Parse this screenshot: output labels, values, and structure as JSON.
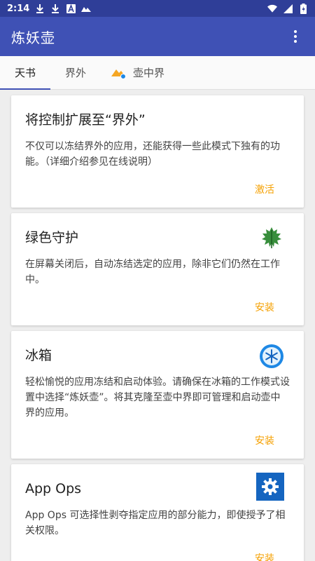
{
  "status_bar": {
    "time": "2:14"
  },
  "app_bar": {
    "title": "炼妖壶"
  },
  "tabs": [
    {
      "label": "天书"
    },
    {
      "label": "界外"
    },
    {
      "label": "壶中界"
    }
  ],
  "cards": [
    {
      "title": "将控制扩展至“界外”",
      "description": "不仅可以冻结界外的应用，还能获得一些此模式下独有的功能。（详细介绍参见在线说明）",
      "action": "激活"
    },
    {
      "title": "绿色守护",
      "description": "在屏幕关闭后，自动冻结选定的应用，除非它们仍然在工作中。",
      "action": "安装"
    },
    {
      "title": "冰箱",
      "description": "轻松愉悦的应用冻结和启动体验。请确保在冰箱的工作模式设置中选择“炼妖壶”。将其克隆至壶中界即可管理和启动壶中界的应用。",
      "action": "安装"
    },
    {
      "title": "App Ops",
      "description": "App Ops 可选择性剥夺指定应用的部分能力，即使授予了相关权限。",
      "action": "安装"
    }
  ],
  "colors": {
    "status_bar": "#2f3e98",
    "app_bar": "#3f51b5",
    "accent": "#f5a000"
  },
  "icons": {
    "greenify": "green-leaf-icon",
    "icebox": "snowflake-icon",
    "appops": "gear-icon"
  }
}
